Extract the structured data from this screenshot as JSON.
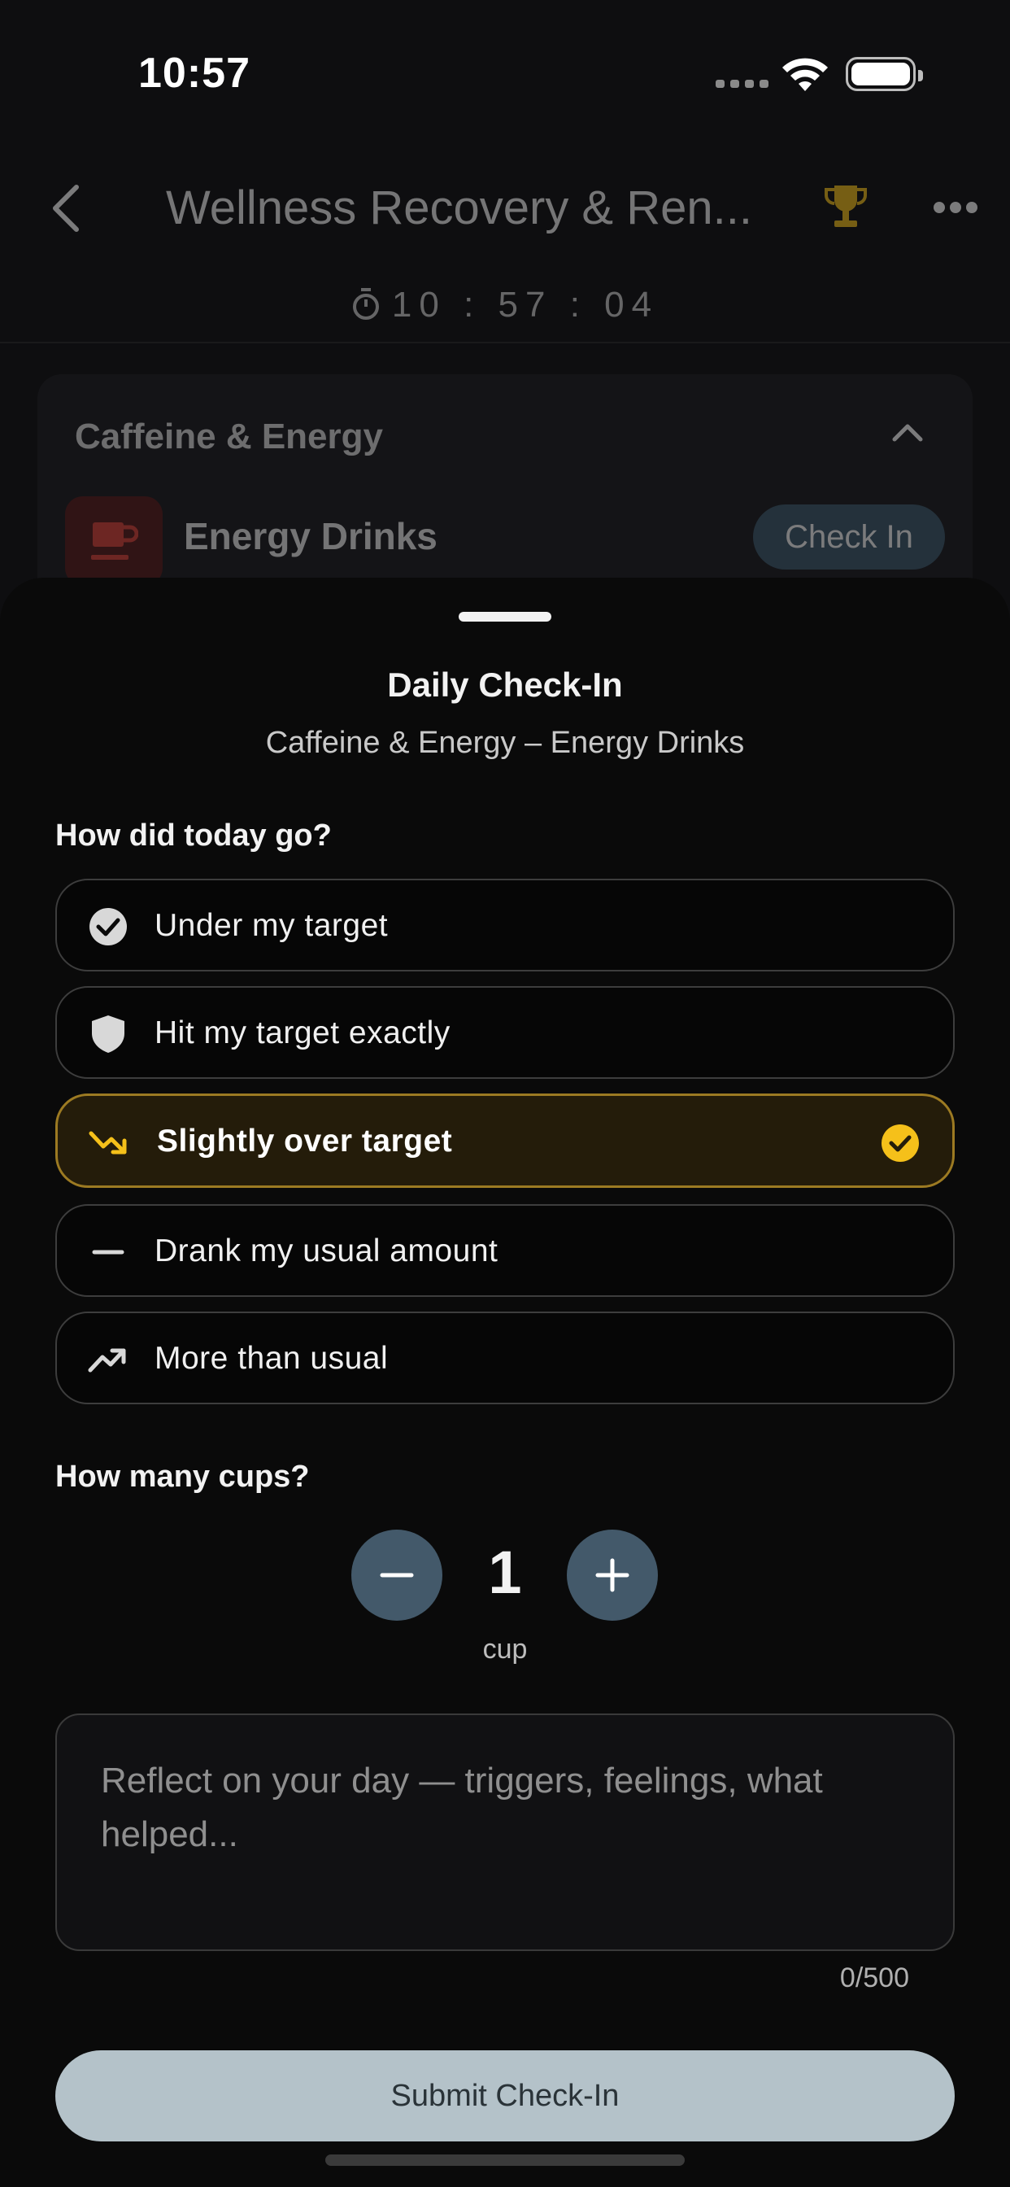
{
  "status_bar": {
    "time": "10:57"
  },
  "nav": {
    "title": "Wellness Recovery & Ren...",
    "timer": "10 : 57 : 04"
  },
  "background": {
    "group_title": "Caffeine & Energy",
    "item_label": "Energy Drinks",
    "checkin_label": "Check In"
  },
  "sheet": {
    "title": "Daily Check-In",
    "subtitle": "Caffeine & Energy – Energy Drinks",
    "question_day": "How did today go?",
    "options": [
      {
        "label": "Under my target",
        "icon": "check-circle-icon",
        "selected": false
      },
      {
        "label": "Hit my target exactly",
        "icon": "shield-icon",
        "selected": false
      },
      {
        "label": "Slightly over target",
        "icon": "trending-down-icon",
        "selected": true
      },
      {
        "label": "Drank my usual amount",
        "icon": "minus-icon",
        "selected": false
      },
      {
        "label": "More than usual",
        "icon": "trending-up-icon",
        "selected": false
      }
    ],
    "question_count": "How many cups?",
    "count": {
      "value": "1",
      "unit": "cup"
    },
    "notes": {
      "placeholder": "Reflect on your day — triggers, feelings, what helped...",
      "value": "",
      "counter": "0/500"
    },
    "submit_label": "Submit Check-In"
  },
  "colors": {
    "accent_gold": "#f5c01a",
    "selected_border": "#9c7a22",
    "selected_bg": "#241c0a",
    "stepper": "#43596a",
    "submit_bg": "#b4c2c9",
    "energy_icon": "#c0392b"
  }
}
